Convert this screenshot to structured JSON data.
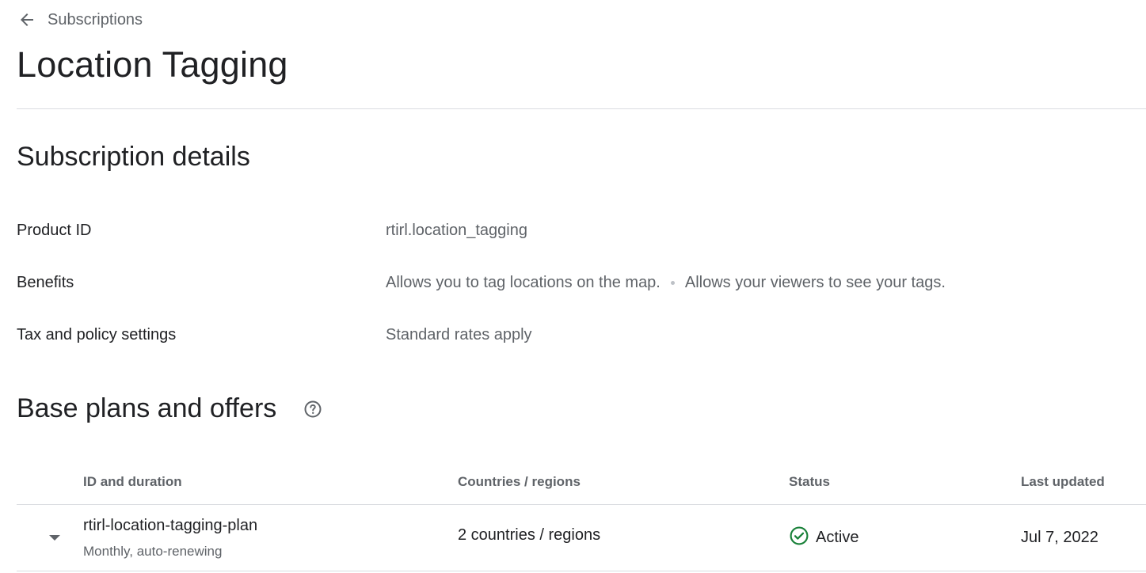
{
  "header": {
    "back_label": "Subscriptions",
    "title": "Location Tagging"
  },
  "details": {
    "section_title": "Subscription details",
    "rows": [
      {
        "label": "Product ID",
        "value": "rtirl.location_tagging"
      },
      {
        "label": "Benefits",
        "values": [
          "Allows you to tag locations on the map.",
          "Allows your viewers to see your tags."
        ]
      },
      {
        "label": "Tax and policy settings",
        "value": "Standard rates apply"
      }
    ]
  },
  "plans": {
    "section_title": "Base plans and offers",
    "help_icon": "help-circle-icon",
    "columns": [
      "ID and duration",
      "Countries / regions",
      "Status",
      "Last updated"
    ],
    "rows": [
      {
        "id": "rtirl-location-tagging-plan",
        "duration": "Monthly, auto-renewing",
        "countries": "2 countries / regions",
        "status": "Active",
        "status_color": "#188038",
        "last_updated": "Jul 7, 2022"
      }
    ]
  }
}
